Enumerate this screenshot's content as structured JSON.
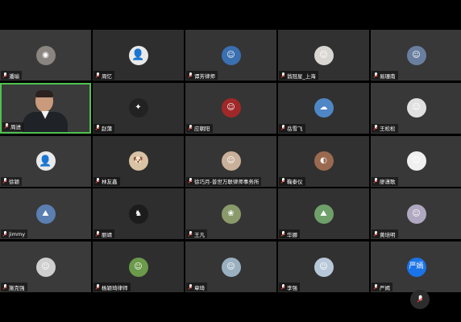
{
  "colors": {
    "background": "#000000",
    "tile_bg": "#333333",
    "active_speaker_border": "#4fc24f",
    "muted_mic": "#e53935",
    "text_avatar_bg": "#1a73e8"
  },
  "participants": [
    {
      "name": "潘瑜",
      "avatar": "photo",
      "tint": "#8a8580",
      "glyph": "◉"
    },
    {
      "name": "周忆",
      "avatar": "default",
      "glyph": "👤"
    },
    {
      "name": "谭芳律师",
      "avatar": "photo",
      "tint": "#3a6fb0",
      "glyph": "☺"
    },
    {
      "name": "翁冠星_上海",
      "avatar": "photo",
      "tint": "#d9d6d2",
      "glyph": "☺"
    },
    {
      "name": "易珊南",
      "avatar": "photo",
      "tint": "#6a7fa0",
      "glyph": "☺"
    },
    {
      "name": "周进",
      "avatar": "video",
      "active": true
    },
    {
      "name": "赵蒲",
      "avatar": "photo",
      "tint": "#222222",
      "glyph": "✦"
    },
    {
      "name": "应朝阳",
      "avatar": "photo",
      "tint": "#a02828",
      "glyph": "☺"
    },
    {
      "name": "岳雪飞",
      "avatar": "photo",
      "tint": "#4f86c6",
      "glyph": "☁"
    },
    {
      "name": "王松松",
      "avatar": "photo",
      "tint": "#e0e0e0",
      "glyph": "☺"
    },
    {
      "name": "徐颖",
      "avatar": "default",
      "glyph": "👤"
    },
    {
      "name": "林友鑫",
      "avatar": "photo",
      "tint": "#d8c3a5",
      "glyph": "🐶"
    },
    {
      "name": "徐巧月-普世万联律师事务所",
      "avatar": "photo",
      "tint": "#c9b09a",
      "glyph": "☺"
    },
    {
      "name": "鞠泰仪",
      "avatar": "photo",
      "tint": "#9a6a50",
      "glyph": "◐"
    },
    {
      "name": "廖潇歌",
      "avatar": "photo",
      "tint": "#f0f0f0",
      "glyph": "☺"
    },
    {
      "name": "jimmy",
      "avatar": "photo",
      "tint": "#5a7fb0",
      "glyph": "⛰"
    },
    {
      "name": "丽靖",
      "avatar": "photo",
      "tint": "#1c1c1c",
      "glyph": "♞"
    },
    {
      "name": "王凡",
      "avatar": "photo",
      "tint": "#8a9a6a",
      "glyph": "❀"
    },
    {
      "name": "华娜",
      "avatar": "photo",
      "tint": "#6fa06a",
      "glyph": "⛰"
    },
    {
      "name": "黄培明",
      "avatar": "photo",
      "tint": "#b0a8c0",
      "glyph": "☺"
    },
    {
      "name": "施克强",
      "avatar": "photo",
      "tint": "#cfcfcf",
      "glyph": "☺"
    },
    {
      "name": "杨颖琦律师",
      "avatar": "photo",
      "tint": "#6a9a4a",
      "glyph": "☺"
    },
    {
      "name": "章琦",
      "avatar": "photo",
      "tint": "#9ab0c0",
      "glyph": "☺"
    },
    {
      "name": "李强",
      "avatar": "photo",
      "tint": "#b8c8d8",
      "glyph": "☺"
    },
    {
      "name": "严嫣",
      "avatar": "text",
      "glyph": "严嫣"
    }
  ],
  "controls": {
    "mic_icon": "microphone-muted-icon"
  }
}
